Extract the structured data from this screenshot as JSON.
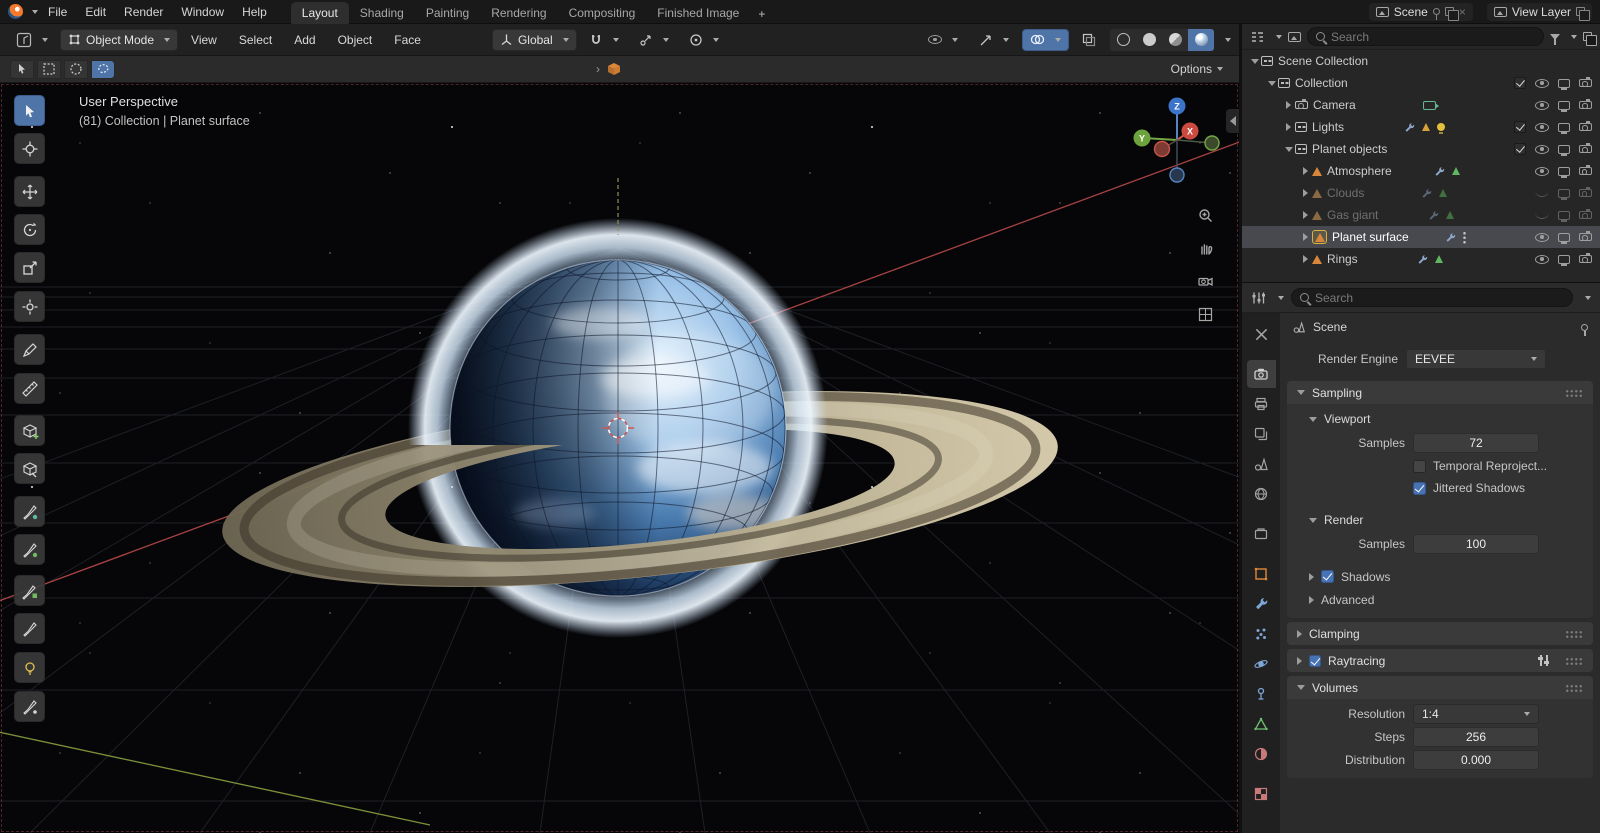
{
  "glyphs": {
    "add_workspace": "+",
    "close": "×",
    "chevron": "›"
  },
  "colors": {
    "accent": "#4772b3",
    "selection_orange": "#e0883a",
    "active_tool_blue": "#4f74a8"
  },
  "topbar": {
    "menus": [
      "File",
      "Edit",
      "Render",
      "Window",
      "Help"
    ],
    "workspaces": [
      "Layout",
      "Shading",
      "Painting",
      "Rendering",
      "Compositing",
      "Finished Image"
    ],
    "active_workspace": "Layout",
    "scene_label": "Scene",
    "view_layer_label": "View Layer"
  },
  "viewport_header": {
    "mode": "Object Mode",
    "menus": [
      "View",
      "Select",
      "Add",
      "Object",
      "Face"
    ],
    "orientation": "Global",
    "options_label": "Options"
  },
  "viewport": {
    "title": "User Perspective",
    "subtitle": "(81) Collection | Planet surface",
    "axis_x": "X",
    "axis_y": "Y",
    "axis_z": "Z"
  },
  "outliner": {
    "search_placeholder": "Search",
    "rows": [
      {
        "label": "Scene Collection"
      },
      {
        "label": "Collection"
      },
      {
        "label": "Camera"
      },
      {
        "label": "Lights"
      },
      {
        "label": "Planet objects"
      },
      {
        "label": "Atmosphere"
      },
      {
        "label": "Clouds"
      },
      {
        "label": "Gas giant"
      },
      {
        "label": "Planet surface"
      },
      {
        "label": "Rings"
      }
    ]
  },
  "properties": {
    "search_placeholder": "Search",
    "breadcrumb": "Scene",
    "render_engine_label": "Render Engine",
    "render_engine_value": "EEVEE",
    "sampling_title": "Sampling",
    "viewport_title": "Viewport",
    "viewport_samples_label": "Samples",
    "viewport_samples_value": "72",
    "temporal_label": "Temporal Reproject...",
    "jittered_label": "Jittered Shadows",
    "render_title": "Render",
    "render_samples_label": "Samples",
    "render_samples_value": "100",
    "shadows_label": "Shadows",
    "advanced_label": "Advanced",
    "clamping_title": "Clamping",
    "raytracing_title": "Raytracing",
    "volumes_title": "Volumes",
    "resolution_label": "Resolution",
    "resolution_value": "1:4",
    "steps_label": "Steps",
    "steps_value": "256",
    "distribution_label": "Distribution",
    "distribution_value": "0.000"
  }
}
